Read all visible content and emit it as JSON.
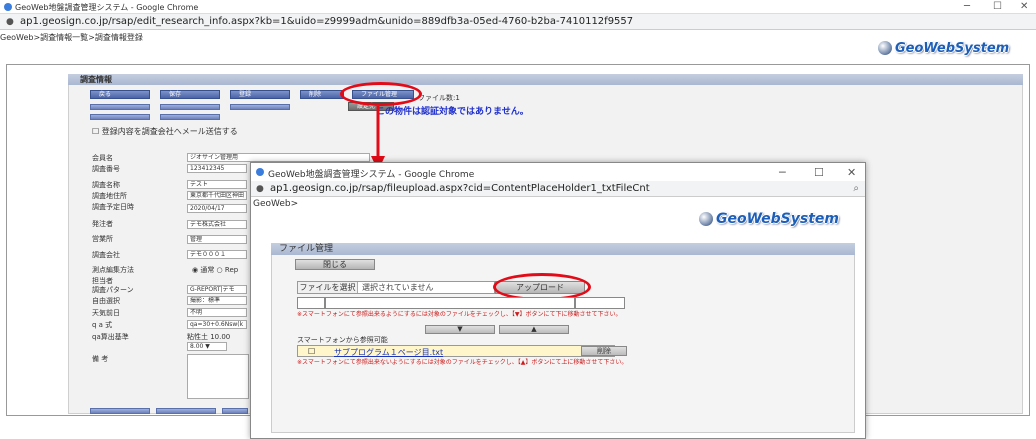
{
  "main_window": {
    "title": "GeoWeb地盤調査管理システム - Google Chrome",
    "url": "ap1.geosign.co.jp/rsap/edit_research_info.aspx?kb=1&uido=z9999adm&unido=889dfb3a-05ed-4760-b2ba-7410112f9557",
    "breadcrumb": "GeoWeb>調査情報一覧>調査情報登録",
    "logo_text": "GeoWebSystem",
    "section_title": "調査情報",
    "buttons": {
      "back": "戻る",
      "save": "保存",
      "register": "登録",
      "delete": "削除",
      "file_manage": "ファイル管理",
      "lock": "設定完了"
    },
    "file_count": "ファイル数:1",
    "notice": "この物件は認証対象ではありません。",
    "email_checkbox": "登録内容を調査会社へメール送信する",
    "form": [
      {
        "label": "会員名",
        "value": "ジオサイン管理用"
      },
      {
        "label": "調査番号",
        "value": "123412345"
      },
      {
        "label": "調査名称",
        "value": "テスト"
      },
      {
        "label": "調査地住所",
        "value": "東京都千代田区神田"
      },
      {
        "label": "調査予定日時",
        "value": "2020/04/17"
      },
      {
        "label": "発注者",
        "value": "デモ株式会社"
      },
      {
        "label": "営業所",
        "value": "管理"
      },
      {
        "label": "調査会社",
        "value": "デモ０００１"
      },
      {
        "label": "測点編集方法",
        "value": "◉ 通常 ○ Rep"
      },
      {
        "label": "担当者",
        "value": ""
      },
      {
        "label": "調査パターン",
        "value": "G-REPORT|デモ"
      },
      {
        "label": "自由選択",
        "value": "撮影：標準"
      },
      {
        "label": "天気前日",
        "value": "不明"
      },
      {
        "label": "q a 式",
        "value": "qa=30+0.6Nsw(k"
      },
      {
        "label": "qa算出基準",
        "value": "粘性土  10.00"
      },
      {
        "label": "",
        "value": "8.00 ▼"
      },
      {
        "label": "備 考",
        "value": ""
      }
    ],
    "controls": {
      "minimize": "─",
      "maximize": "☐",
      "close": "✕"
    }
  },
  "popup": {
    "title": "GeoWeb地盤調査管理システム - Google Chrome",
    "url": "ap1.geosign.co.jp/rsap/fileupload.aspx?cid=ContentPlaceHolder1_txtFileCnt",
    "breadcrumb": "GeoWeb>",
    "logo_text": "GeoWebSystem",
    "section_title": "ファイル管理",
    "close_button": "閉じる",
    "file_select_button": "ファイルを選択",
    "file_select_text": "選択されていません",
    "upload_button": "アップロード",
    "warn_down": "※スマートフォンにて参照出来るようにするには対象のファイルをチェックし、【▼】ボタンにて下に移動させて下さい。",
    "down_arrow": "▼",
    "up_arrow": "▲",
    "smartphone_label": "スマートフォンから参照可能",
    "file_name": "サブプログラム１ページ目.txt",
    "delete_button": "削除",
    "warn_up": "※スマートフォンにて参照出来ないようにするには対象のファイルをチェックし、【▲】ボタンにて上に移動させて下さい。",
    "zoom_icon": "⌕",
    "controls": {
      "minimize": "─",
      "maximize": "☐",
      "close": "✕"
    }
  },
  "colors": {
    "highlight": "#e30b17",
    "notice": "#1e2fcc",
    "button": "#4b64a8"
  }
}
